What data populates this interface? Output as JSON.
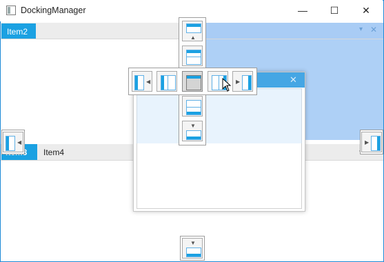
{
  "window": {
    "title": "DockingManager",
    "controls": {
      "minimize": "—",
      "maximize": "☐",
      "close": "✕"
    }
  },
  "panes": {
    "item2": {
      "label": "Item2",
      "menu_glyph": "▾",
      "close_glyph": "✕"
    },
    "item3": {
      "label": "Item3",
      "menu_glyph": "▾",
      "close_glyph": "✕"
    },
    "item4": {
      "label": "Item4"
    }
  },
  "floating_window": {
    "close_glyph": "✕"
  },
  "dock_guide": {
    "targets": [
      "dock-top",
      "dock-bottom",
      "dock-left",
      "dock-right",
      "dock-center",
      "dock-inner-left",
      "dock-inner-right",
      "dock-inner-top",
      "dock-inner-bottom",
      "dock-outer-left",
      "dock-outer-right",
      "dock-outer-bottom"
    ]
  },
  "colors": {
    "accent": "#1ba1e2",
    "preview": "#a9ccf5",
    "float_title": "#45a6e4"
  }
}
